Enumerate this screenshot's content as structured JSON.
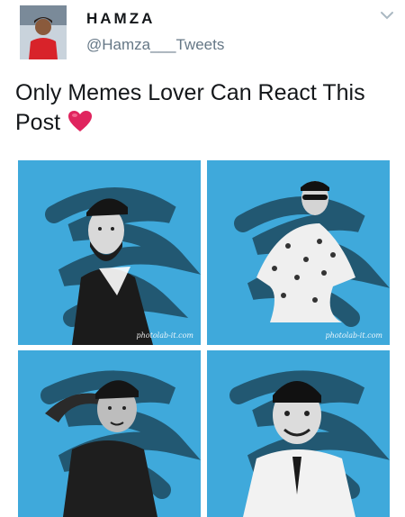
{
  "author": {
    "display_name": "HAMZA",
    "handle": "@Hamza___Tweets",
    "avatar_icon": "avatar-photo"
  },
  "menu_icon": "chevron-down-icon",
  "tweet": {
    "text": "Only Memes Lover Can React This Post",
    "emoji": "red-heart"
  },
  "media": {
    "tiles": [
      {
        "subject": "portrait-cap-beard",
        "watermark": "photolab-it.com"
      },
      {
        "subject": "portrait-sunglasses-patterned-shirt",
        "watermark": "photolab-it.com"
      },
      {
        "subject": "portrait-salute-cap",
        "watermark": ""
      },
      {
        "subject": "portrait-fez-smile",
        "watermark": ""
      }
    ]
  },
  "colors": {
    "tile_background": "#3fa9db",
    "brush_stroke": "#1f4f66",
    "heart": "#e0245e",
    "handle_gray": "#657786"
  }
}
